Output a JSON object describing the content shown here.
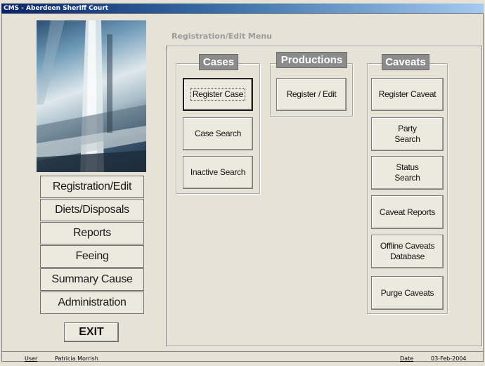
{
  "window": {
    "title": "CMS - Aberdeen Sheriff Court"
  },
  "sidebar": {
    "items": [
      {
        "label": "Registration/Edit"
      },
      {
        "label": "Diets/Disposals"
      },
      {
        "label": "Reports"
      },
      {
        "label": "Feeing"
      },
      {
        "label": "Summary Cause"
      },
      {
        "label": "Administration"
      }
    ],
    "exit_label": "EXIT"
  },
  "main": {
    "menu_title": "Registration/Edit Menu",
    "groups": {
      "cases": {
        "title": "Cases",
        "buttons": [
          "Register Case",
          "Case Search",
          "Inactive Search"
        ]
      },
      "productions": {
        "title": "Productions",
        "buttons": [
          "Register / Edit"
        ]
      },
      "caveats": {
        "title": "Caveats",
        "buttons": [
          "Register Caveat",
          "Party\nSearch",
          "Status\nSearch",
          "Caveat Reports",
          "Offline Caveats\nDatabase",
          "Purge Caveats"
        ]
      }
    }
  },
  "statusbar": {
    "user_label": "User",
    "user_value": "Patricia Morrish",
    "date_label": "Date",
    "date_value": "03-Feb-2004"
  }
}
